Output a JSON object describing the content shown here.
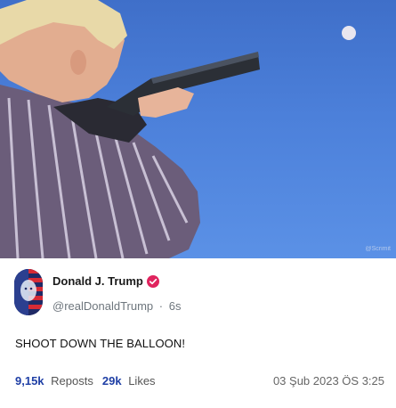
{
  "photo": {
    "alt": "Person aiming shotgun at balloon",
    "watermark": "@Scrimit"
  },
  "post": {
    "display_name": "Donald J. Trump",
    "verified_icon": "verified-badge-icon",
    "handle": "@realDonaldTrump",
    "separator": "·",
    "age": "6s",
    "text": "SHOOT DOWN THE BALLOON!",
    "reposts_count": "9,15k",
    "reposts_label": "Reposts",
    "likes_count": "29k",
    "likes_label": "Likes",
    "timestamp": "03 Şub 2023 ÖS 3:25"
  },
  "colors": {
    "sky": "#4c80da",
    "stat_number": "#1f3fa5",
    "verified": "#e0245e"
  }
}
